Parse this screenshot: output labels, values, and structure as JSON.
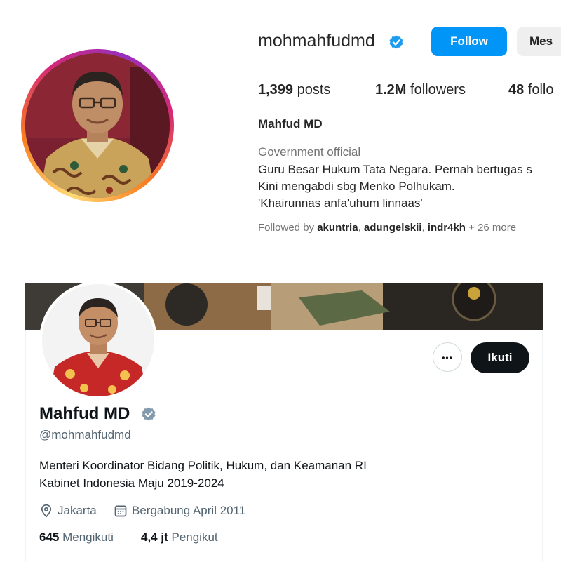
{
  "instagram": {
    "username": "mohmahfudmd",
    "follow_label": "Follow",
    "message_label": "Mes",
    "stats": {
      "posts_value": "1,399",
      "posts_label": "posts",
      "followers_value": "1.2M",
      "followers_label": "followers",
      "following_value": "48",
      "following_label": "follo"
    },
    "full_name": "Mahfud MD",
    "category": "Government official",
    "bio": [
      "Guru Besar Hukum Tata Negara. Pernah bertugas s",
      "Kini mengabdi sbg Menko Polhukam.",
      "'Khairunnas anfa'uhum linnaas'"
    ],
    "followed_by": {
      "prefix": "Followed by",
      "users": [
        "akuntria",
        "adungelskii",
        "indr4kh"
      ],
      "more": "+ 26 more"
    }
  },
  "twitter": {
    "more_label": "•••",
    "follow_label": "Ikuti",
    "name": "Mahfud MD",
    "handle": "@mohmahfudmd",
    "bio": [
      "Menteri Koordinator Bidang Politik, Hukum, dan Keamanan RI",
      "Kabinet Indonesia Maju 2019-2024"
    ],
    "location": "Jakarta",
    "joined": "Bergabung April 2011",
    "following_value": "645",
    "following_label": "Mengikuti",
    "followers_value": "4,4 jt",
    "followers_label": "Pengikut"
  },
  "colors": {
    "ig_blue": "#0095f6",
    "tw_dark": "#0f1419",
    "tw_gray": "#536471",
    "verified_blue": "#1d9bf0",
    "verified_gray": "#829aab"
  },
  "icons": [
    "verified-badge-icon",
    "location-pin-icon",
    "calendar-icon",
    "more-dots-icon"
  ]
}
